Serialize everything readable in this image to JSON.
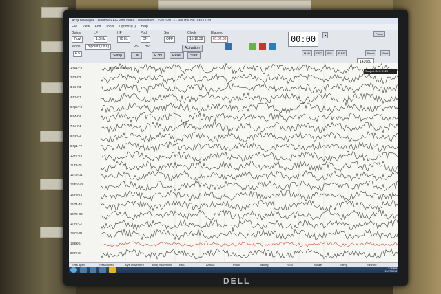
{
  "window": {
    "title": "AcqKnowlegde - Routine EEG with Video - Duo/Vitalm - 19/07/2013 - Volume No.00000018"
  },
  "menu": [
    "File",
    "View",
    "Edit",
    "Tools",
    "Options(O)",
    "Help"
  ],
  "toolbar": {
    "labels": [
      "Gains",
      "LF",
      "HF",
      "Pod",
      "Sort",
      "Clock",
      "Elapsed"
    ],
    "values": [
      "7 uV",
      "1.6 Hz",
      "70 Hz",
      "ON",
      "OFF",
      "15:10:38",
      "01:02:08"
    ],
    "montage_label": "Mode",
    "montage_value": "Bipolar (2 x 8)",
    "speed": "6.5",
    "checks": [
      "PS",
      "HV"
    ],
    "buttons": [
      "Setup",
      "Cal",
      "F HV",
      "Reset",
      "Start",
      "Activation"
    ],
    "clock_display": "00:00",
    "right_buttons": [
      "MAN",
      "DEC",
      "INC",
      "F-PS",
      "Pause",
      "Reset",
      "Start"
    ],
    "counter": "143680"
  },
  "channels": [
    "1 Fp1-F3",
    "2 F3-C3",
    "3 C3-P3",
    "4 P3-O1",
    "5 Fp2-F4",
    "6 F4-C4",
    "7 C4-P4",
    "8 P4-O2",
    "9 Fp1-F7",
    "10 F7-T3",
    "11 T3-T5",
    "12 T5-O1",
    "13 Fp2-F8",
    "14 F8-T4",
    "15 T4-T6",
    "16 T6-O2",
    "17 Fz-Cz",
    "18 Cz-Pz",
    "19 EKG",
    "20 PHO"
  ],
  "trace_annotation": "Double Sensor",
  "trace_tag": "Subject Ref +0123",
  "events": [
    "Eyes open",
    "Eyes closed",
    "Eye movement",
    "Body movement",
    "EMG",
    "Artifact",
    "Photic",
    "Talking",
    "REM",
    "Awake",
    "Sleep",
    "Seizure"
  ],
  "tray": {
    "time": "3:36 PM",
    "date": "19/07/2013"
  },
  "brand": "DELL"
}
